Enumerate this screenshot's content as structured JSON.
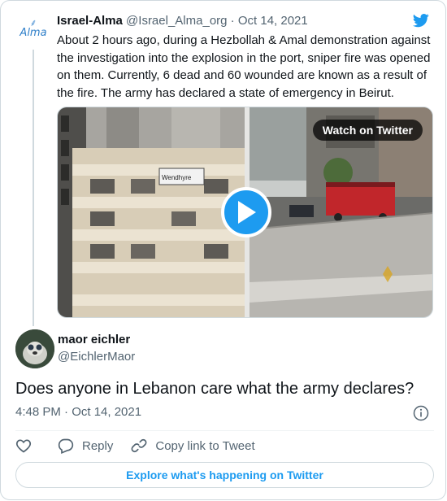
{
  "quoted_tweet": {
    "avatar_text": "Alma",
    "name": "Israel-Alma",
    "handle": "@Israel_Alma_org",
    "separator": "·",
    "date": "Oct 14, 2021",
    "text": "About 2 hours ago, during a Hezbollah & Amal demonstration against the investigation into the explosion in the port, sniper fire was opened on them. Currently, 6 dead and 60 wounded are known as a result of the fire. The army has declared a state of emergency in Beirut.",
    "media": {
      "watch_label": "Watch on Twitter",
      "overlay_sign_text": "Wendhyre"
    }
  },
  "tweet": {
    "name": "maor eichler",
    "handle": "@EichlerMaor",
    "text": "Does anyone in Lebanon care what the army declares?",
    "time": "4:48 PM · Oct 14, 2021"
  },
  "actions": {
    "reply_label": "Reply",
    "copy_link_label": "Copy link to Tweet"
  },
  "explore_label": "Explore what's happening on Twitter",
  "colors": {
    "accent": "#1d9bf0",
    "text_primary": "#0f1419",
    "text_secondary": "#536471",
    "border": "#cfd9de"
  },
  "icons": [
    "alma-logo-icon",
    "twitter-bird-icon",
    "play-icon",
    "info-icon",
    "heart-icon",
    "reply-icon",
    "link-icon"
  ]
}
